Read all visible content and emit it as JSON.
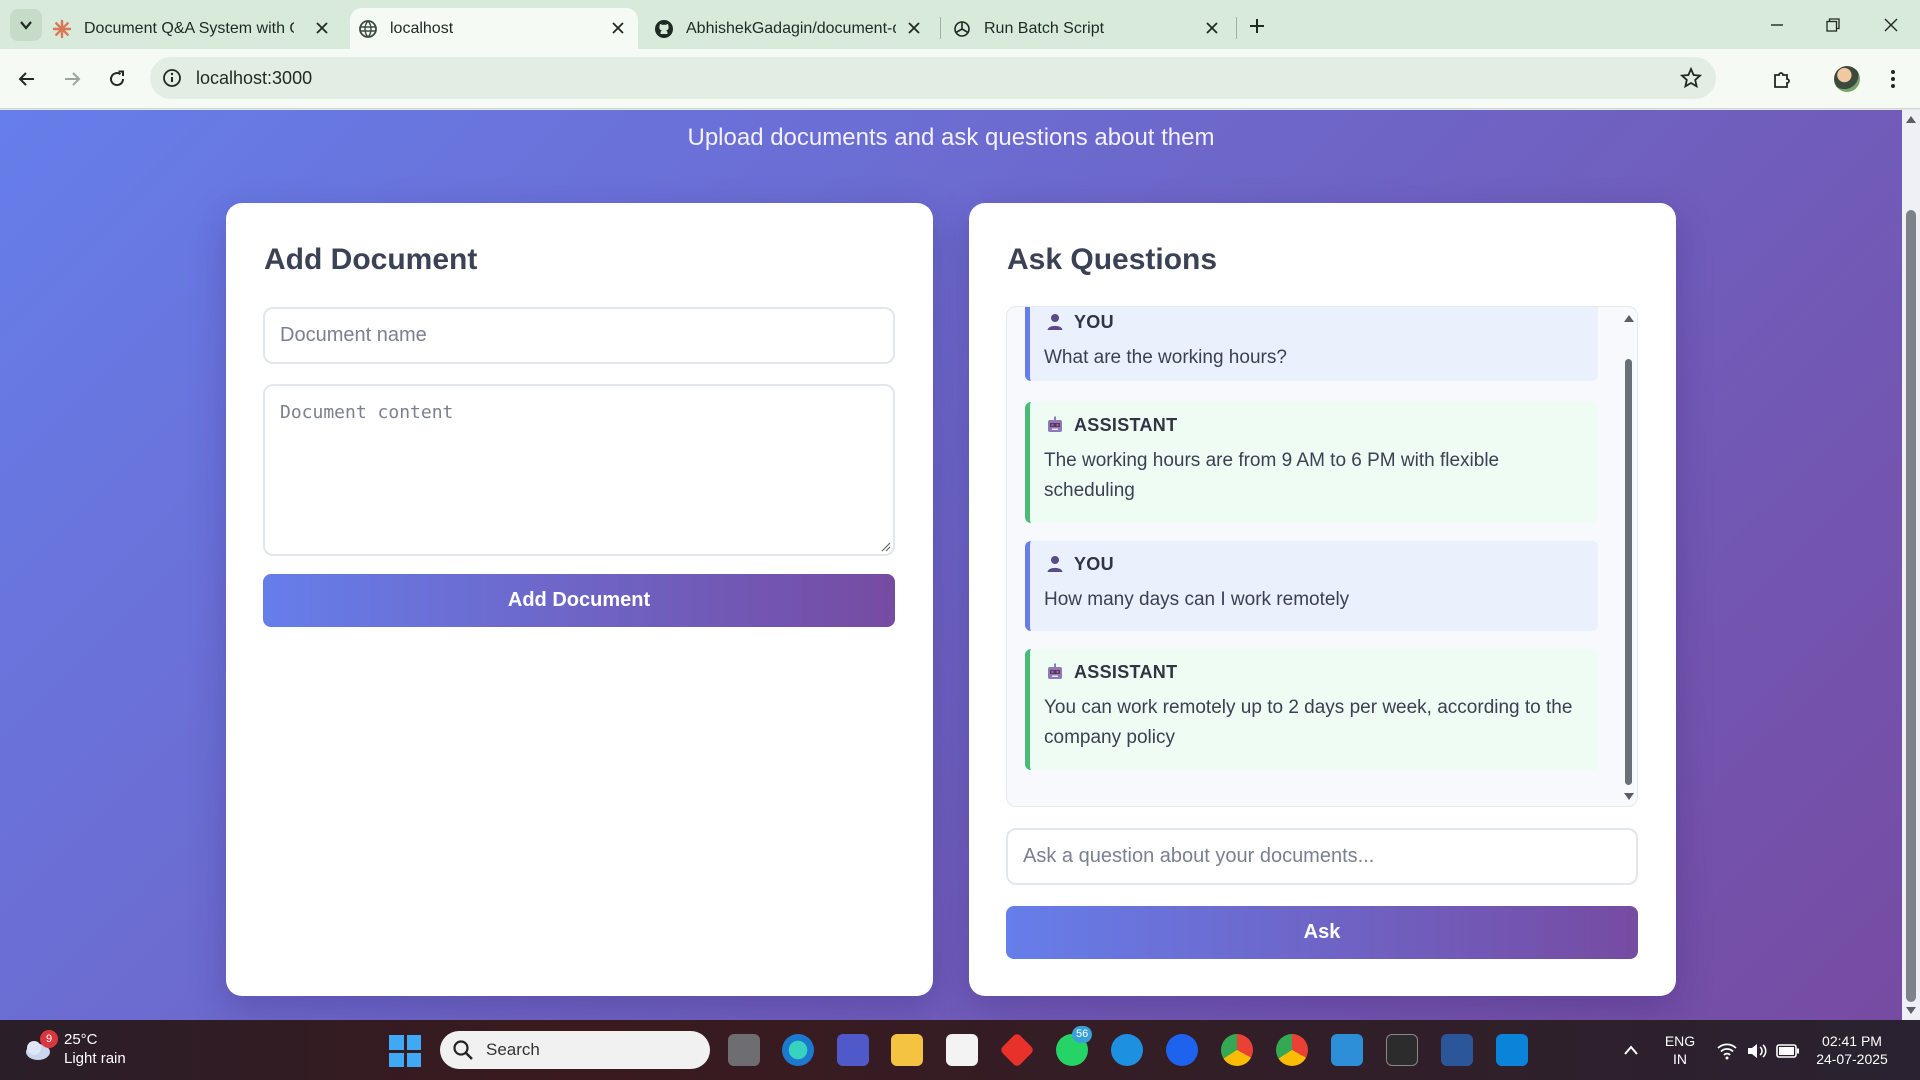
{
  "browser": {
    "tabs": [
      {
        "title": "Document Q&A System with Q",
        "favicon": "asterisk-icon"
      },
      {
        "title": "localhost",
        "favicon": "globe-icon",
        "active": true
      },
      {
        "title": "AbhishekGadagin/document-q",
        "favicon": "github-icon"
      },
      {
        "title": "Run Batch Script",
        "favicon": "openai-icon"
      }
    ],
    "url": "localhost:3000"
  },
  "page": {
    "subtitle": "Upload documents and ask questions about them",
    "add_document": {
      "heading": "Add Document",
      "name_placeholder": "Document name",
      "content_placeholder": "Document content",
      "button_label": "Add Document"
    },
    "ask": {
      "heading": "Ask Questions",
      "messages": [
        {
          "role": "YOU",
          "type": "user",
          "text": "What are the working hours?"
        },
        {
          "role": "ASSISTANT",
          "type": "assistant",
          "text": "The working hours are from 9 AM to 6 PM with flexible scheduling"
        },
        {
          "role": "YOU",
          "type": "user",
          "text": "How many days can I work remotely"
        },
        {
          "role": "ASSISTANT",
          "type": "assistant",
          "text": "You can work remotely up to 2 days per week, according to the company policy"
        }
      ],
      "input_placeholder": "Ask a question about your documents...",
      "button_label": "Ask"
    }
  },
  "taskbar": {
    "weather_badge": "9",
    "temperature": "25°C",
    "condition": "Light rain",
    "search_label": "Search",
    "whatsapp_badge": "56",
    "language_line1": "ENG",
    "language_line2": "IN",
    "time": "02:41 PM",
    "date": "24-07-2025"
  },
  "colors": {
    "gradient_start": "#667eea",
    "gradient_end": "#764ba2",
    "user_border": "#667eea",
    "assistant_border": "#48bb78"
  }
}
